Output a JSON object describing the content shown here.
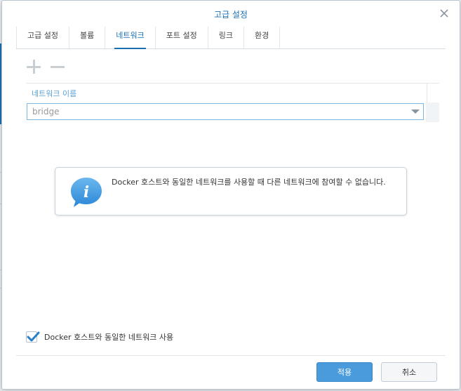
{
  "dialog": {
    "title": "고급 설정",
    "tabs": [
      {
        "label": "고급 설정"
      },
      {
        "label": "볼륨"
      },
      {
        "label": "네트워크"
      },
      {
        "label": "포트 설정"
      },
      {
        "label": "링크"
      },
      {
        "label": "환경"
      }
    ],
    "active_tab": "네트워크",
    "toolbar": {
      "add_icon": "plus-icon",
      "remove_icon": "minus-icon"
    },
    "network_grid": {
      "column_header": "네트워크 이름",
      "selected_value": "bridge"
    },
    "info_message": "Docker 호스트와 동일한 네트워크를 사용할 때 다른 네트워크에 참여할 수 없습니다.",
    "checkbox": {
      "label": "Docker 호스트와 동일한 네트워크 사용",
      "checked": true
    },
    "buttons": {
      "apply": "적용",
      "cancel": "취소"
    },
    "colors": {
      "accent": "#1a6fb3",
      "apply_button": "#4a9bdc",
      "header_link": "#5ea3d8"
    }
  }
}
